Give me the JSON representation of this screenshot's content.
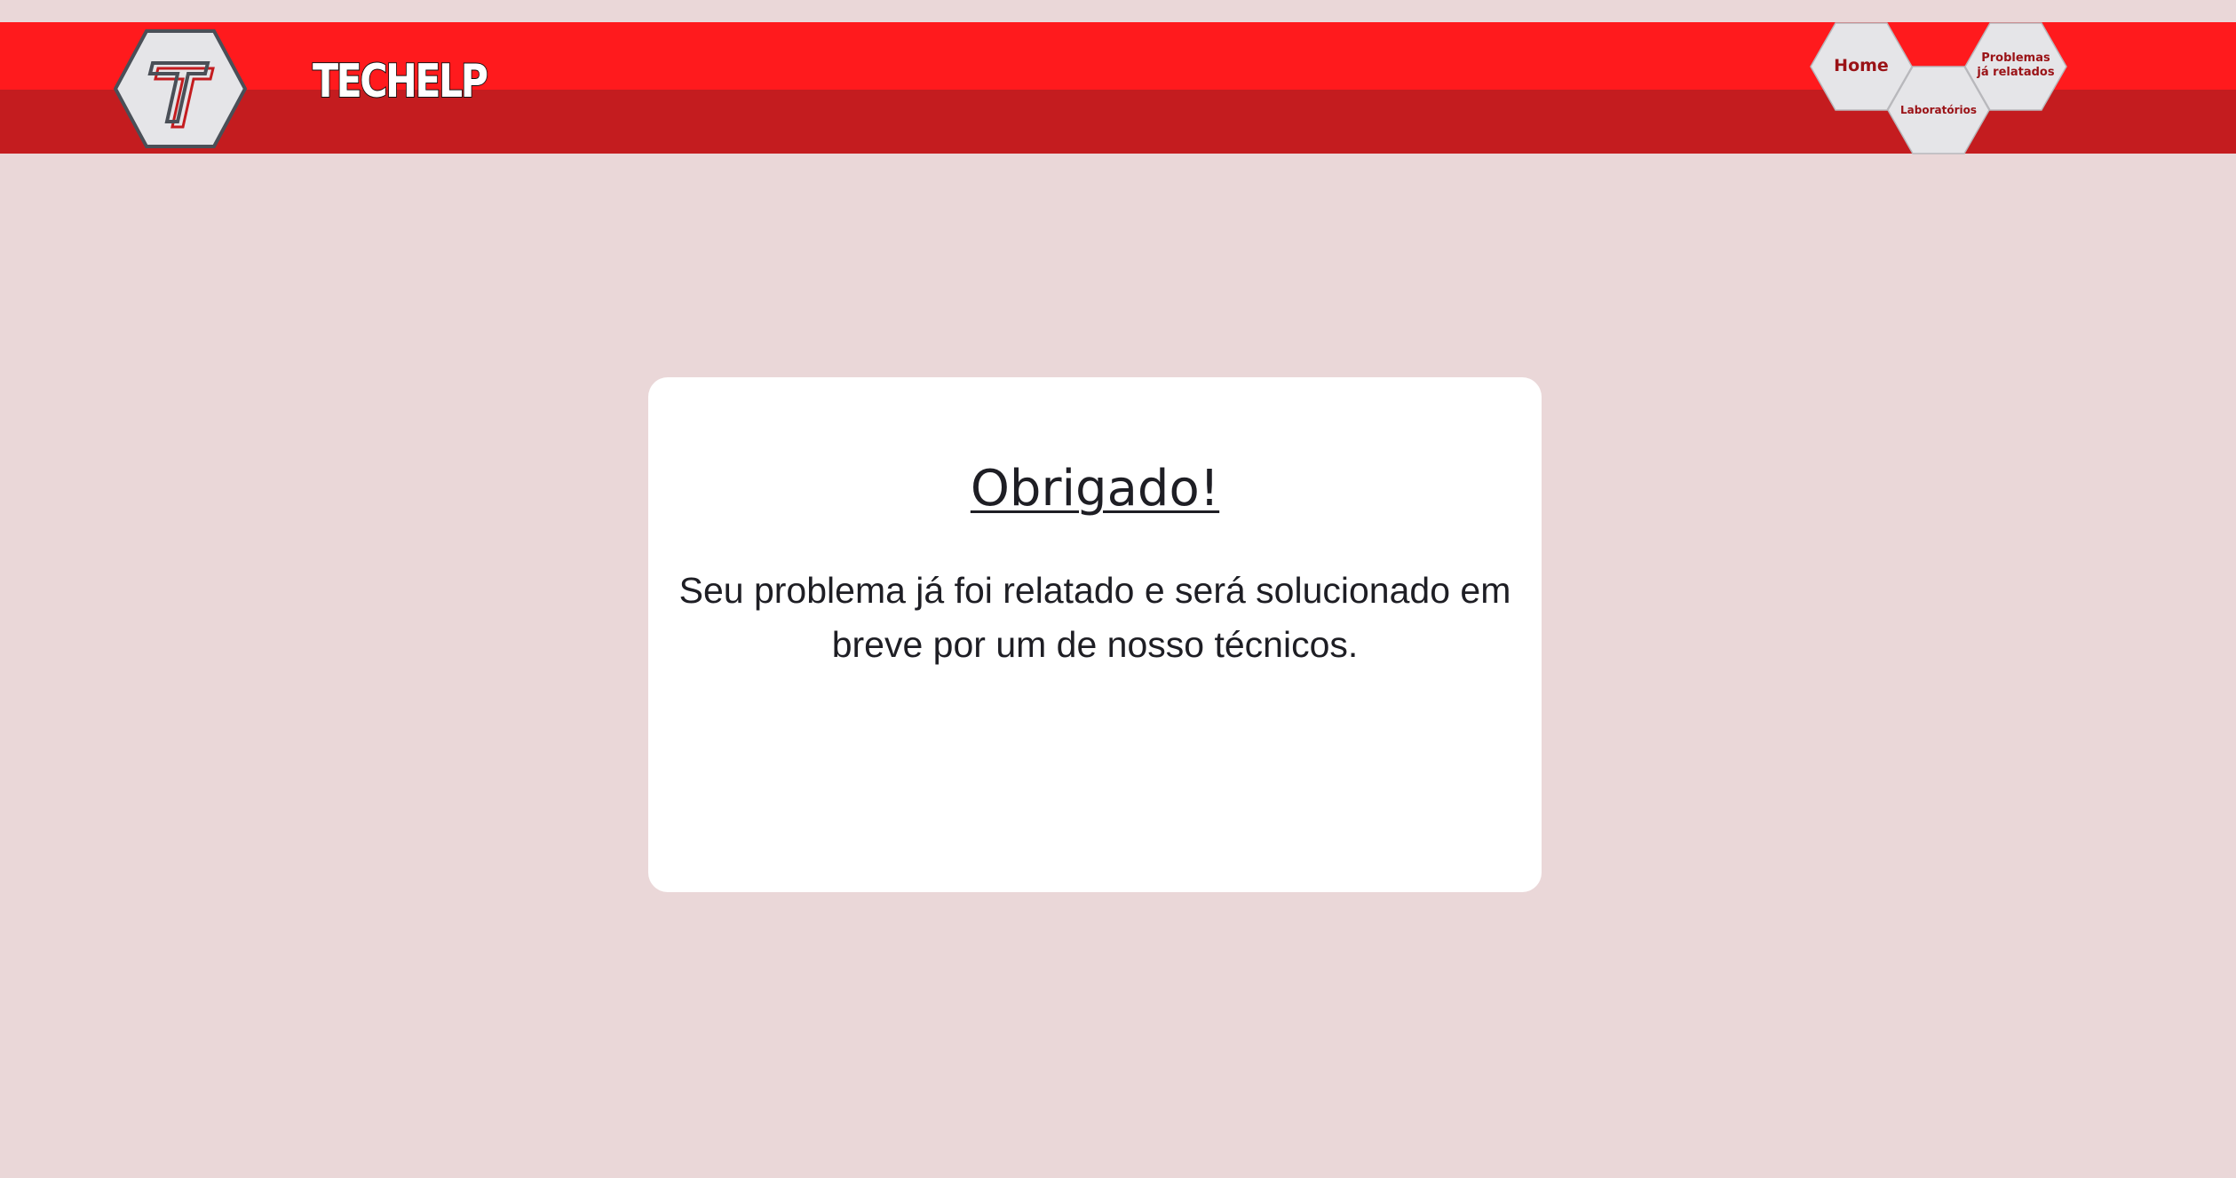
{
  "header": {
    "brand": "TECHELP",
    "logo_letter": "T",
    "colors": {
      "top": "#ff1a1d",
      "bottom": "#c41c1f",
      "hex_fill": "#e5e5e8",
      "hex_stroke": "#4a4f57",
      "nav_text": "#9a1216"
    }
  },
  "nav": {
    "home": "Home",
    "labs": "Laboratórios",
    "problems_line1": "Problemas",
    "problems_line2": "já relatados"
  },
  "card": {
    "title": "Obrigado!",
    "message": "Seu problema já foi relatado e será solucionado em breve por um de nosso técnicos."
  },
  "page": {
    "background": "#ead7d8"
  }
}
